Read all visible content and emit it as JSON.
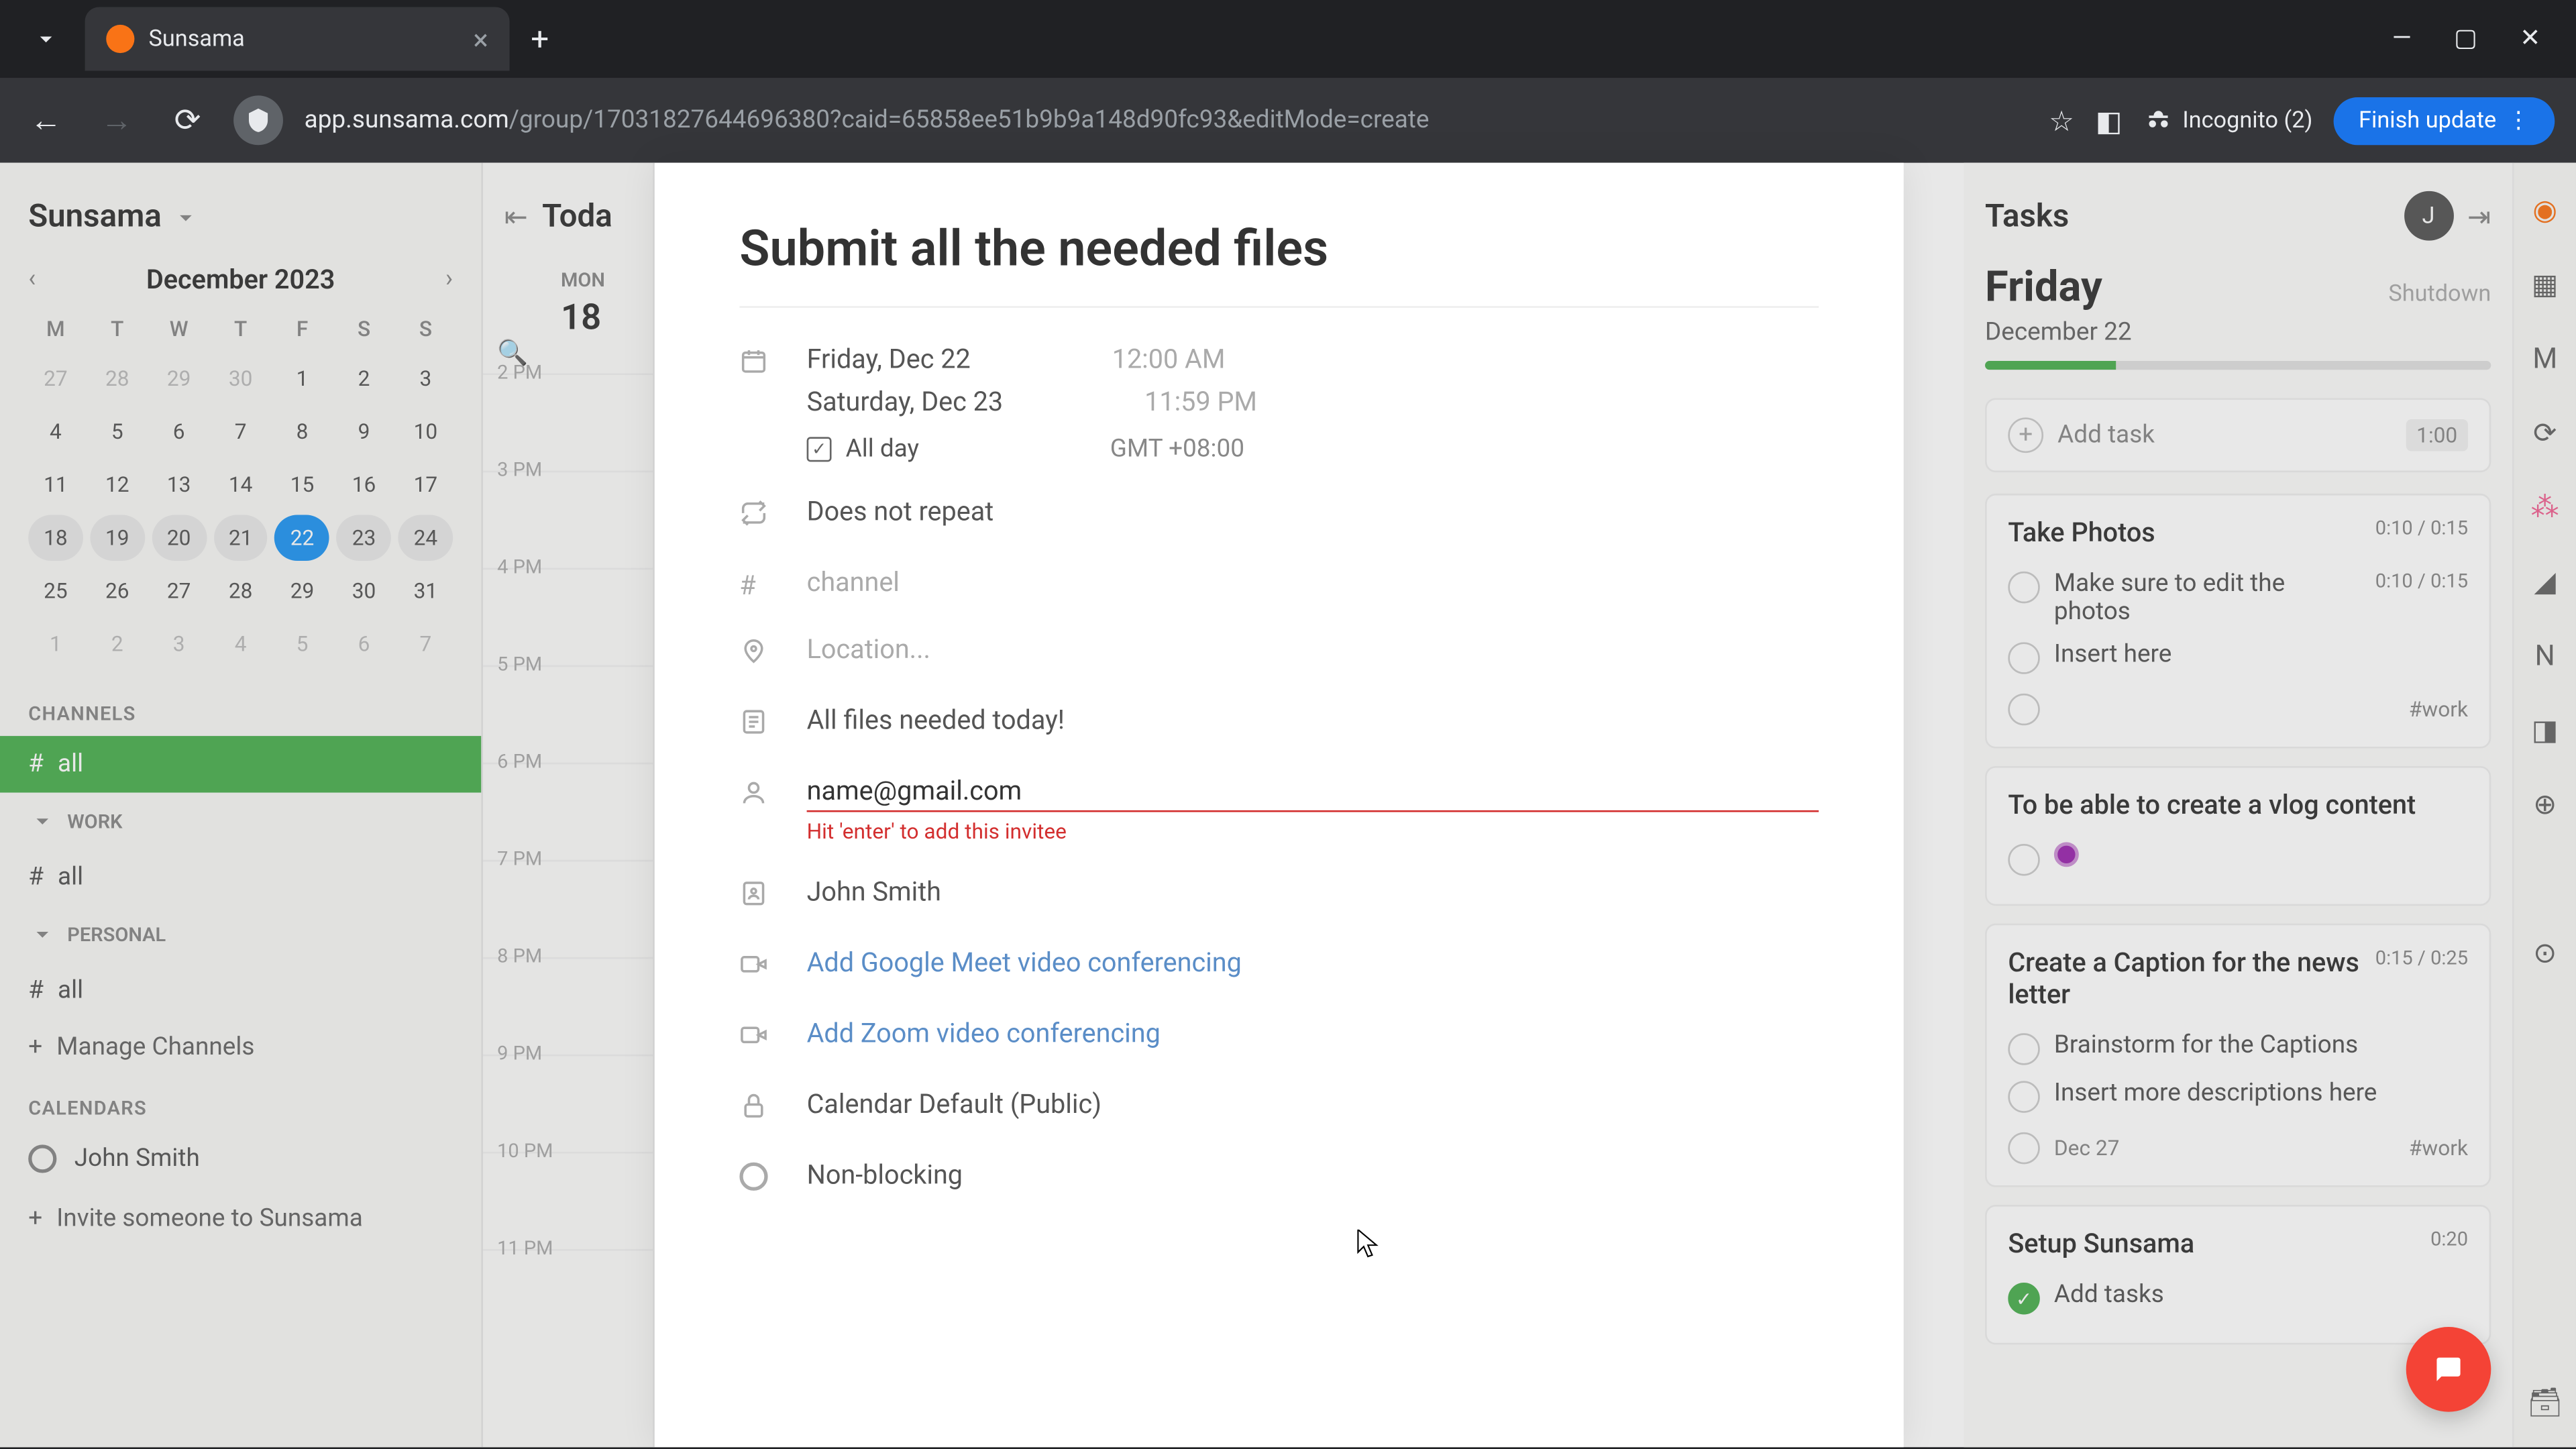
{
  "browser": {
    "tab_title": "Sunsama",
    "url_domain": "app.sunsama.com",
    "url_path": "/group/17031827644696380?caid=65858ee51b9b9a148d90fc93&editMode=create",
    "incognito": "Incognito (2)",
    "finish_update": "Finish update"
  },
  "sidebar": {
    "workspace": "Sunsama",
    "cal_month": "December 2023",
    "dow": [
      "M",
      "T",
      "W",
      "T",
      "F",
      "S",
      "S"
    ],
    "days": [
      {
        "n": "27",
        "o": true
      },
      {
        "n": "28",
        "o": true
      },
      {
        "n": "29",
        "o": true
      },
      {
        "n": "30",
        "o": true
      },
      {
        "n": "1"
      },
      {
        "n": "2"
      },
      {
        "n": "3"
      },
      {
        "n": "4"
      },
      {
        "n": "5"
      },
      {
        "n": "6"
      },
      {
        "n": "7"
      },
      {
        "n": "8"
      },
      {
        "n": "9"
      },
      {
        "n": "10"
      },
      {
        "n": "11"
      },
      {
        "n": "12"
      },
      {
        "n": "13"
      },
      {
        "n": "14"
      },
      {
        "n": "15"
      },
      {
        "n": "16"
      },
      {
        "n": "17"
      },
      {
        "n": "18"
      },
      {
        "n": "19"
      },
      {
        "n": "20"
      },
      {
        "n": "21"
      },
      {
        "n": "22",
        "sel": true
      },
      {
        "n": "23"
      },
      {
        "n": "24"
      },
      {
        "n": "25"
      },
      {
        "n": "26"
      },
      {
        "n": "27"
      },
      {
        "n": "28"
      },
      {
        "n": "29"
      },
      {
        "n": "30"
      },
      {
        "n": "31"
      },
      {
        "n": "1",
        "o": true
      },
      {
        "n": "2",
        "o": true
      },
      {
        "n": "3",
        "o": true
      },
      {
        "n": "4",
        "o": true
      },
      {
        "n": "5",
        "o": true
      },
      {
        "n": "6",
        "o": true
      },
      {
        "n": "7",
        "o": true
      }
    ],
    "channels_label": "CHANNELS",
    "channel_all": "all",
    "work_label": "WORK",
    "work_all": "all",
    "personal_label": "PERSONAL",
    "personal_all": "all",
    "manage": "Manage Channels",
    "calendars_label": "CALENDARS",
    "cal_name": "John Smith",
    "invite": "Invite someone to Sunsama"
  },
  "calstrip": {
    "today": "Toda",
    "dow": "MON",
    "daynum": "18",
    "hours": [
      "2 PM",
      "3 PM",
      "4 PM",
      "5 PM",
      "6 PM",
      "7 PM",
      "8 PM",
      "9 PM",
      "10 PM",
      "11 PM"
    ]
  },
  "modal": {
    "title": "Submit all the needed files",
    "start_date": "Friday, Dec 22",
    "start_time": "12:00 AM",
    "end_date": "Saturday, Dec 23",
    "end_time": "11:59 PM",
    "all_day": "All day",
    "tz": "GMT +08:00",
    "repeat": "Does not repeat",
    "channel_ph": "channel",
    "location_ph": "Location...",
    "notes": "All files needed today!",
    "invitee": "name@gmail.com",
    "invitee_hint": "Hit 'enter' to add this invitee",
    "organizer": "John Smith",
    "gmeet": "Add Google Meet video conferencing",
    "zoom": "Add Zoom video conferencing",
    "calendar": "Calendar Default (Public)",
    "blocking": "Non-blocking"
  },
  "tasks": {
    "header": "Tasks",
    "avatar": "J",
    "day": "Friday",
    "shutdown": "Shutdown",
    "date": "December 22",
    "add_task": "Add task",
    "add_time": "1:00",
    "cards": [
      {
        "title": "Take Photos",
        "time": "0:10 / 0:15",
        "subs": [
          {
            "text": "Make sure to edit the photos",
            "time": "0:10 / 0:15"
          },
          {
            "text": "Insert here"
          }
        ],
        "tag": "#work"
      },
      {
        "title": "To be able to create a vlog content",
        "purple": true
      },
      {
        "title": "Create a Caption for the news letter",
        "time": "0:15 / 0:25",
        "subs": [
          {
            "text": "Brainstorm for the Captions"
          },
          {
            "text": "Insert more descriptions here"
          }
        ],
        "due": "Dec 27",
        "tag": "#work"
      },
      {
        "title": "Setup Sunsama",
        "time": "0:20",
        "subs": [
          {
            "text": "Add tasks",
            "done": true
          }
        ]
      }
    ]
  }
}
